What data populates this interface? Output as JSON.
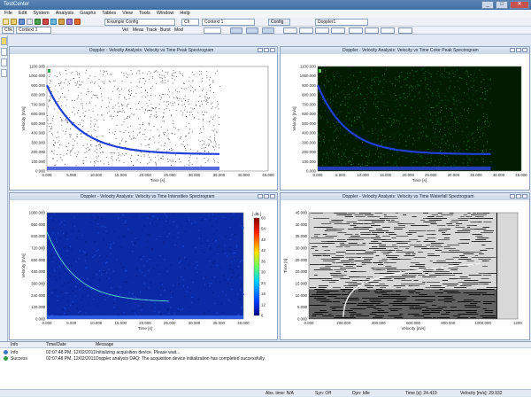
{
  "window": {
    "title": "TestCenter"
  },
  "menu": [
    "File",
    "Edit",
    "System",
    "Analysis",
    "Graphs",
    "Tables",
    "View",
    "Tools",
    "Window",
    "Help"
  ],
  "toolbar": {
    "config_combo": "Example Config",
    "ch_combo": "Ch",
    "context_combo": "Context 1",
    "config_label": "Config",
    "config_value": "Doppler1",
    "ch_small": "Chk",
    "context_small": "Context 1",
    "buttons": [
      "Vel",
      "Meas",
      "Track",
      "Burst",
      "Mod"
    ]
  },
  "panels": [
    {
      "title": "Doppler - Velocity Analysis: Velocity vs Time Peak Spectrogram",
      "ylabel": "Velocity [m/s]",
      "xlabel": "Time [s]",
      "yticks": [
        "1100.000",
        "1000.000",
        "900.000",
        "800.000",
        "700.000",
        "600.000",
        "500.000",
        "400.000",
        "300.000",
        "200.000",
        "100.000",
        "0.000"
      ],
      "xticks": [
        "0.000",
        "5.000",
        "10.000",
        "15.000",
        "20.000",
        "25.000",
        "30.000",
        "35.000",
        "40.000",
        "45.000"
      ]
    },
    {
      "title": "Doppler - Velocity Analysis: Velocity vs Time Color Peak Spectrogram",
      "ylabel": "Velocity [m/s]",
      "xlabel": "Time [s]",
      "yticks": [
        "1100.000",
        "1000.000",
        "900.000",
        "800.000",
        "700.000",
        "600.000",
        "500.000",
        "400.000",
        "300.000",
        "200.000",
        "100.000",
        "0.000"
      ],
      "xticks": [
        "0.000",
        "5.000",
        "10.000",
        "15.000",
        "20.000",
        "25.000",
        "30.000",
        "35.000",
        "40.000",
        "45.000"
      ]
    },
    {
      "title": "Doppler - Velocity Analysis: Velocity vs Time Intensities Spectrogram",
      "ylabel": "Velocity [m/s]",
      "xlabel": "Time [s]",
      "yticks": [
        "1080.000",
        "960.000",
        "840.000",
        "720.000",
        "600.000",
        "480.000",
        "360.000",
        "240.000",
        "120.000",
        "0.000"
      ],
      "xticks": [
        "0.000",
        "5.000",
        "10.000",
        "15.000",
        "20.000",
        "25.000",
        "30.000",
        "35.000",
        "40.000"
      ],
      "colorbar_unit": "[ dB ]",
      "colorbar_ticks": [
        "60",
        "54",
        "48",
        "42",
        "36",
        "30",
        "24",
        "18",
        "12",
        "6"
      ]
    },
    {
      "title": "Doppler - Velocity Analysis: Velocity vs Time Waterfall Spectrogram",
      "ylabel": "Time [s]",
      "xlabel": "Velocity [m/s]",
      "yticks": [
        "45.000",
        "40.000",
        "35.000",
        "30.000",
        "25.000",
        "20.000",
        "15.000",
        "10.000",
        "5.000",
        "0.000"
      ],
      "xticks": [
        "0.000",
        "200.000",
        "400.000",
        "600.000",
        "800.000",
        "1000.000",
        "1200"
      ]
    }
  ],
  "log": {
    "headers": [
      "Info",
      "Time/Date",
      "Message"
    ],
    "rows": [
      {
        "status": "Info",
        "time": "02:07:48 PM, 12/02/2011",
        "message": "Initializing acquisition device. Please wait..."
      },
      {
        "status": "Success",
        "time": "02:07:48 PM, 12/02/2011",
        "message": "Doppler analysis DAQ: The acquisition device initialization has completed successfully."
      }
    ]
  },
  "status": {
    "abs_time": "Abs. time: N/A",
    "sync": "Syn: Off",
    "dyn": "Dyn: Idle",
    "time_val": "Time [s]: 24.419",
    "velocity_val": "Velocity [m/s]: 29.932"
  },
  "colors": {
    "curve": "#1f3fd8",
    "grid_dark": "#000000",
    "green_plot_bg": "#021c02"
  }
}
